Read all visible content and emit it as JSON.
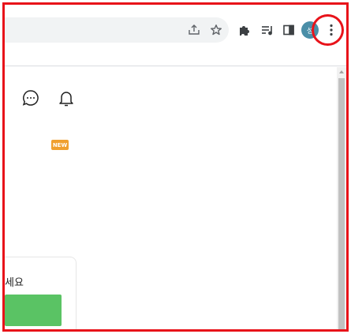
{
  "toolbar": {
    "avatar_initial": "성",
    "icons": {
      "share": "share-icon",
      "bookmark": "star-icon",
      "extensions": "puzzle-icon",
      "reading_list": "reading-list-icon",
      "side_panel": "side-panel-icon",
      "menu": "kebab-menu-icon"
    },
    "highlight_color": "#e8131a"
  },
  "page": {
    "header_icons": [
      "chat-bubble-icon",
      "bell-icon"
    ],
    "new_badge": "NEW",
    "card_text": "세요",
    "card_button_color": "#5ac364"
  }
}
